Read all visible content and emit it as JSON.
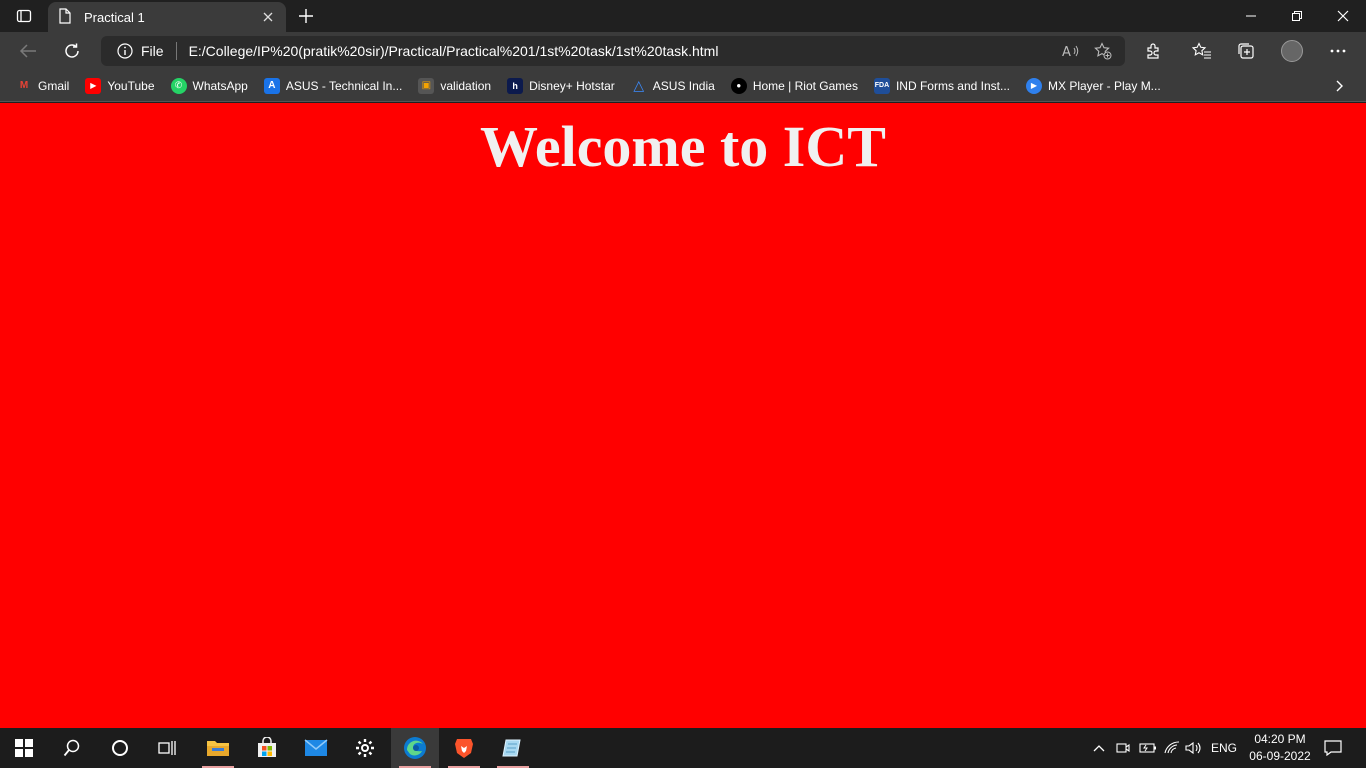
{
  "browser": {
    "tab_title": "Practical 1",
    "address": {
      "scheme_label": "File",
      "url": "E:/College/IP%20(pratik%20sir)/Practical/Practical%201/1st%20task/1st%20task.html"
    }
  },
  "bookmarks": [
    {
      "label": "Gmail",
      "icon": "gmail-icon",
      "color": "#ea4335",
      "glyph": "M"
    },
    {
      "label": "YouTube",
      "icon": "youtube-icon",
      "color": "#ff0000",
      "glyph": "▶"
    },
    {
      "label": "WhatsApp",
      "icon": "whatsapp-icon",
      "color": "#25d366",
      "glyph": "✆"
    },
    {
      "label": "ASUS - Technical In...",
      "icon": "asus-icon",
      "color": "#1a73e8",
      "glyph": "A"
    },
    {
      "label": "validation",
      "icon": "validation-icon",
      "color": "#f4a300",
      "glyph": "▣"
    },
    {
      "label": "Disney+ Hotstar",
      "icon": "hotstar-icon",
      "color": "#0c1a4d",
      "glyph": "h"
    },
    {
      "label": "ASUS India",
      "icon": "asus-india-icon",
      "color": "#1a73e8",
      "glyph": "△"
    },
    {
      "label": "Home | Riot Games",
      "icon": "riot-icon",
      "color": "#000000",
      "glyph": "●"
    },
    {
      "label": "IND Forms and Inst...",
      "icon": "fda-icon",
      "color": "#1f4e99",
      "glyph": "F"
    },
    {
      "label": "MX Player - Play M...",
      "icon": "mxplayer-icon",
      "color": "#2f80ed",
      "glyph": "▶"
    }
  ],
  "page": {
    "heading": "Welcome to ICT",
    "background": "#ff0000",
    "heading_color": "#f0f0f0"
  },
  "taskbar": {
    "language": "ENG",
    "time": "04:20 PM",
    "date": "06-09-2022"
  }
}
